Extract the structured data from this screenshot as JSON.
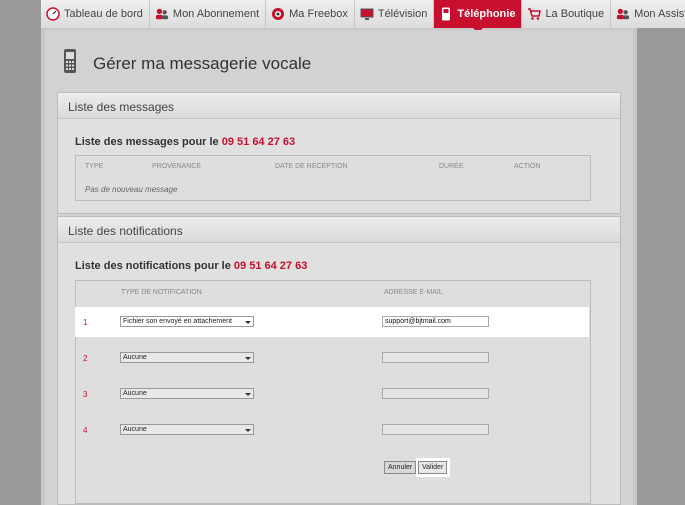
{
  "nav": {
    "items": [
      {
        "label": "Tableau de bord",
        "icon": "dashboard-gauge-icon"
      },
      {
        "label": "Mon Abonnement",
        "icon": "users-icon"
      },
      {
        "label": "Ma Freebox",
        "icon": "freebox-icon"
      },
      {
        "label": "Télévision",
        "icon": "tv-icon"
      },
      {
        "label": "Téléphonie",
        "icon": "mobile-phone-icon",
        "active": true
      },
      {
        "label": "La Boutique",
        "icon": "cart-icon"
      },
      {
        "label": "Mon Assistance",
        "icon": "support-users-icon"
      }
    ]
  },
  "page": {
    "title": "Gérer ma messagerie vocale"
  },
  "messages": {
    "section_title": "Liste des messages",
    "subtitle_prefix": "Liste des messages pour le",
    "phone_number": "09 51 64 27 63",
    "columns": [
      "TYPE",
      "PROVENANCE",
      "DATE DE RECEPTION",
      "DURÉE",
      "ACTION"
    ],
    "empty_text": "Pas de nouveau message"
  },
  "notifications": {
    "section_title": "Liste des notifications",
    "subtitle_prefix": "Liste des notifications pour le",
    "phone_number": "09 51 64 27 63",
    "columns": [
      "TYPE DE NOTIFICATION",
      "ADRESSE E-MAIL"
    ],
    "rows": [
      {
        "num": "1",
        "type": "Fichier son envoyé en attachement",
        "email": "support@bjtmail.com"
      },
      {
        "num": "2",
        "type": "Aucune",
        "email": ""
      },
      {
        "num": "3",
        "type": "Aucune",
        "email": ""
      },
      {
        "num": "4",
        "type": "Aucune",
        "email": ""
      }
    ],
    "cancel_label": "Annuler",
    "submit_label": "Valider"
  },
  "colors": {
    "accent": "#c8102e",
    "background": "#9a9a9a"
  }
}
